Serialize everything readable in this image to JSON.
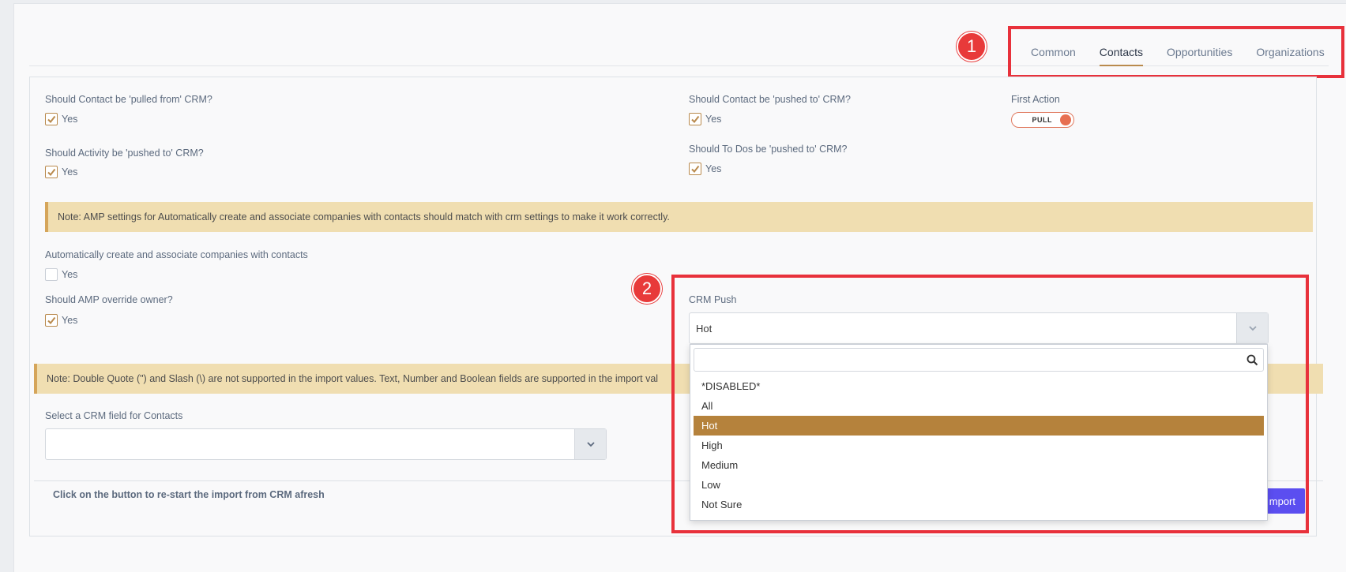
{
  "tabs": [
    {
      "label": "Common"
    },
    {
      "label": "Contacts"
    },
    {
      "label": "Opportunities"
    },
    {
      "label": "Organizations"
    }
  ],
  "annotations": {
    "one": "1",
    "two": "2"
  },
  "questions": {
    "pulled_from": "Should Contact be 'pulled from' CRM?",
    "activity_pushed": "Should Activity be 'pushed to' CRM?",
    "contact_pushed": "Should Contact be 'pushed to' CRM?",
    "todos_pushed": "Should To Dos be 'pushed to' CRM?",
    "auto_create": "Automatically create and associate companies with contacts",
    "override_owner": "Should AMP override owner?"
  },
  "yes_label": "Yes",
  "first_action": {
    "label": "First Action",
    "toggle_text": "PULL"
  },
  "note1": "Note: AMP settings for Automatically create and associate companies with contacts should match with crm settings to make it work correctly.",
  "note2": "Note: Double Quote (\") and Slash (\\) are not supported in the import values. Text, Number and Boolean fields are supported in the import val",
  "crm_push": {
    "label": "CRM Push",
    "selected": "Hot",
    "search_placeholder": "",
    "options": [
      "*DISABLED*",
      "All",
      "Hot",
      "High",
      "Medium",
      "Low",
      "Not Sure"
    ]
  },
  "crm_field": {
    "label": "Select a CRM field for Contacts",
    "value": ""
  },
  "restart_text": "Click on the button to re-start the import from CRM afresh",
  "import_button": "mport",
  "colors": {
    "accent": "#b98a4d",
    "annotation": "#e8313b",
    "note_bg": "#f0deb1",
    "button": "#5b4ef0",
    "selected_option": "#b5823c"
  }
}
